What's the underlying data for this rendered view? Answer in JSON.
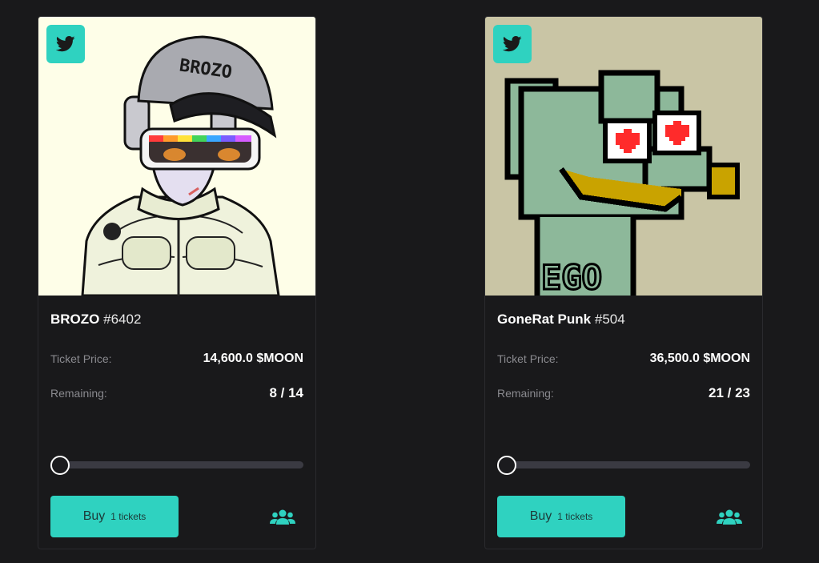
{
  "cards": [
    {
      "name": "BROZO",
      "number": "#6402",
      "price_label": "Ticket Price:",
      "price_value": "14,600.0 $MOON",
      "remaining_label": "Remaining:",
      "remaining_value": "8 / 14",
      "buy_label": "Buy",
      "tickets_label": "1 tickets",
      "cap_text": "BROZO",
      "slider_fraction": 0
    },
    {
      "name": "GoneRat Punk",
      "number": "#504",
      "price_label": "Ticket Price:",
      "price_value": "36,500.0 $MOON",
      "remaining_label": "Remaining:",
      "remaining_value": "21 / 23",
      "buy_label": "Buy",
      "tickets_label": "1 tickets",
      "slider_fraction": 0
    }
  ],
  "colors": {
    "accent": "#2fd2c0",
    "background": "#19191b",
    "track": "#3a3a42"
  },
  "icons": {
    "social": "twitter-icon",
    "participants": "users-icon"
  }
}
